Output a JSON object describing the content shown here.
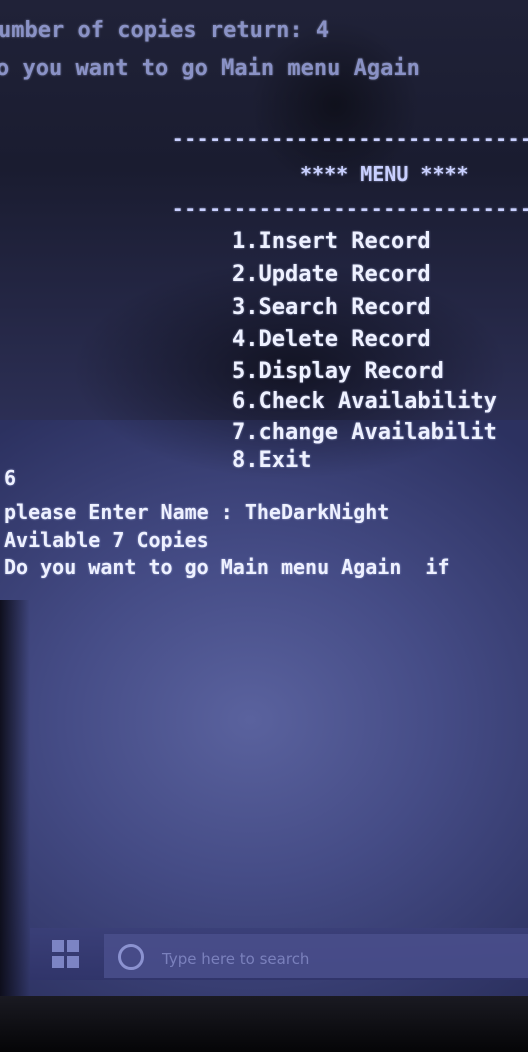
{
  "console": {
    "line_prev_1": "umber of copies return: 4",
    "line_prev_2": "o you want to go Main menu Again",
    "dash_top": "------------------------------",
    "menu_title": "**** MENU ****",
    "dash_bottom": "--------------------------------",
    "menu_items": [
      "1.Insert Record",
      "2.Update Record",
      "3.Search Record",
      "4.Delete Record",
      "5.Display Record",
      "6.Check Availability",
      "7.change Availabilit",
      "8.Exit"
    ],
    "input_choice": "6",
    "prompt_name": "please Enter Name : TheDarkNight",
    "result": "Avilable 7 Copies",
    "prompt_again": "Do you want to go Main menu Again  if"
  },
  "taskbar": {
    "search_placeholder": "Type here to search"
  }
}
